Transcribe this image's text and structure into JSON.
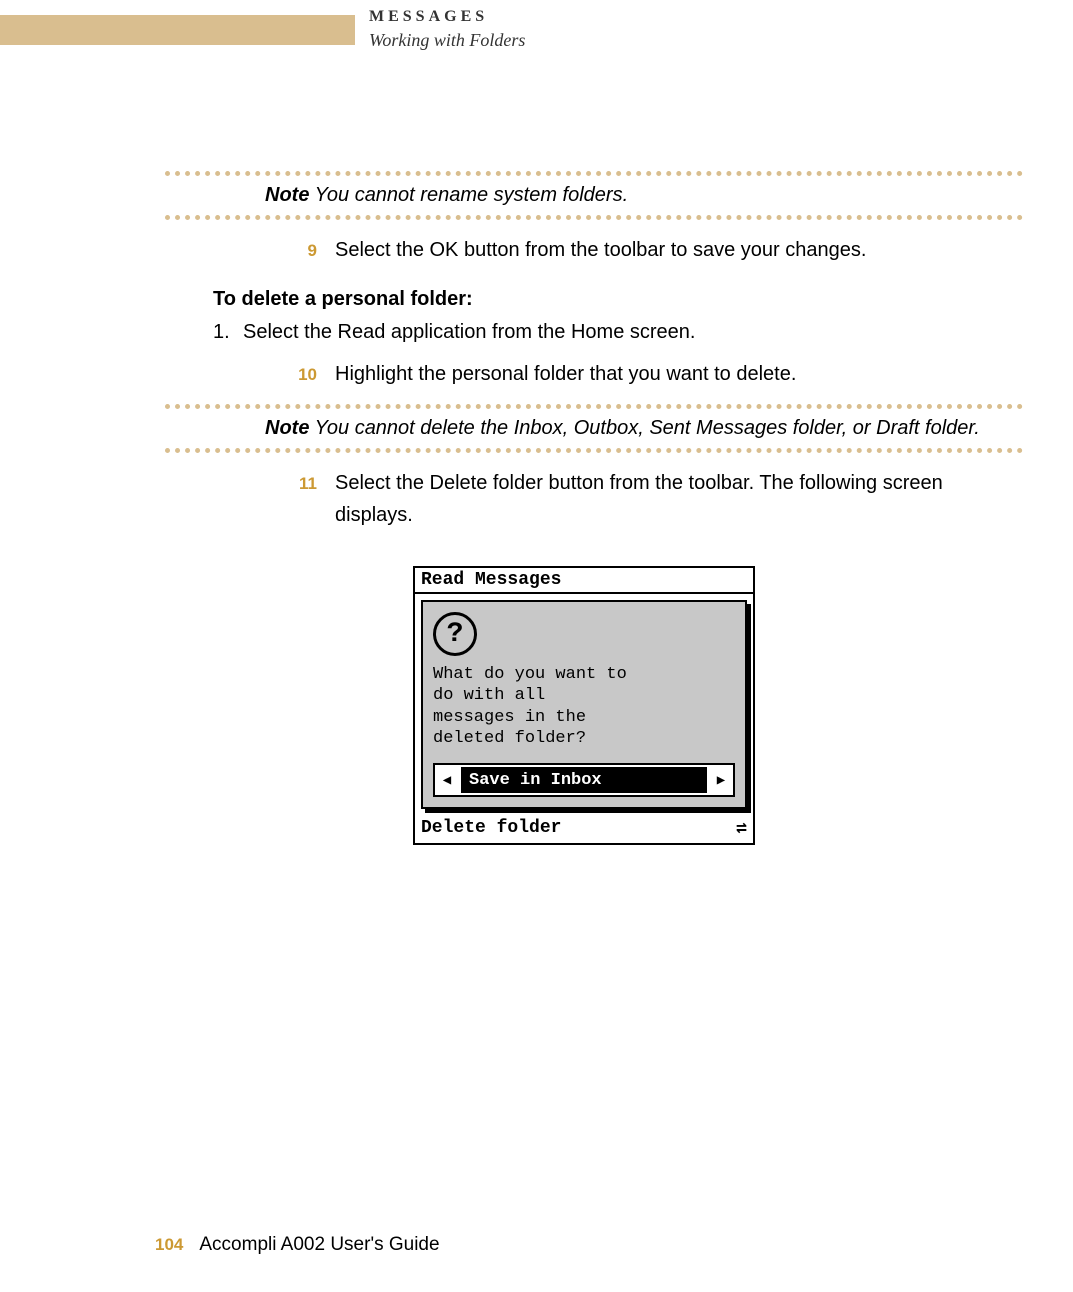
{
  "header": {
    "chapter": "MESSAGES",
    "section": "Working with Folders"
  },
  "notes": {
    "label": "Note",
    "rename_text": " You cannot rename system folders.",
    "delete_text": " You cannot delete the Inbox, Outbox, Sent Messages folder, or Draft folder."
  },
  "steps": {
    "s9": {
      "num": "9",
      "text": "Select the OK button from the toolbar to save your changes."
    },
    "s10": {
      "num": "10",
      "text": "Highlight the personal folder that you want to delete."
    },
    "s11": {
      "num": "11",
      "text": "Select the Delete folder button from the toolbar. The following screen displays."
    }
  },
  "subheading": "To delete a personal folder:",
  "list": {
    "item1": {
      "num": "1.",
      "text": "Select the Read application from the Home screen."
    }
  },
  "device": {
    "title": "Read Messages",
    "question_mark": "?",
    "question_text": "What do you want to\ndo with all\nmessages in the\ndeleted folder?",
    "arrow_left": "◀",
    "option": "Save in Inbox",
    "arrow_right": "▶",
    "footer": "Delete folder",
    "swap": "⇌"
  },
  "footer": {
    "page": "104",
    "guide": "Accompli A002 User's Guide"
  }
}
